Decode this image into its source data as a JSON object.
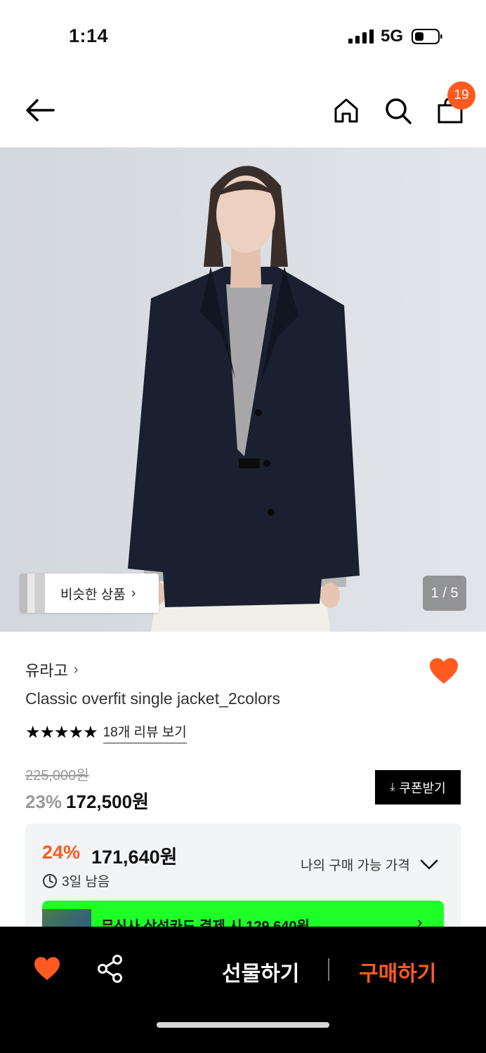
{
  "status_bar": {
    "time": "1:14",
    "network": "5G"
  },
  "nav": {
    "cart_count": "19",
    "icons": [
      "back-arrow-icon",
      "home-icon",
      "search-icon",
      "shopping-bag-icon"
    ]
  },
  "gallery": {
    "similar_label": "비슷한 상품",
    "similar_chevron": "›",
    "page_indicator": "1 / 5"
  },
  "product": {
    "brand": "유라고",
    "brand_chevron": "›",
    "name": "Classic overfit single jacket_2colors",
    "stars": "★★★★★",
    "rating": 5,
    "review_link": "18개 리뷰 보기",
    "original_price": "225,000원",
    "discount": "23%",
    "price": "172,500원",
    "coupon_label": "쿠폰받기",
    "wishlisted": true
  },
  "best_price": {
    "discount": "24%",
    "price": "171,640원",
    "time_left": "3일 남음",
    "my_price_label": "나의 구매 가능 가격",
    "card_banner": "무신사 삼성카드 결제 시 129,640원",
    "card_chevron": "›"
  },
  "bottom_bar": {
    "gift_label": "선물하기",
    "buy_label": "구매하기"
  },
  "colors": {
    "accent": "#ff5a1f",
    "card_banner": "#1eff28",
    "bottom_bar": "#000000"
  }
}
